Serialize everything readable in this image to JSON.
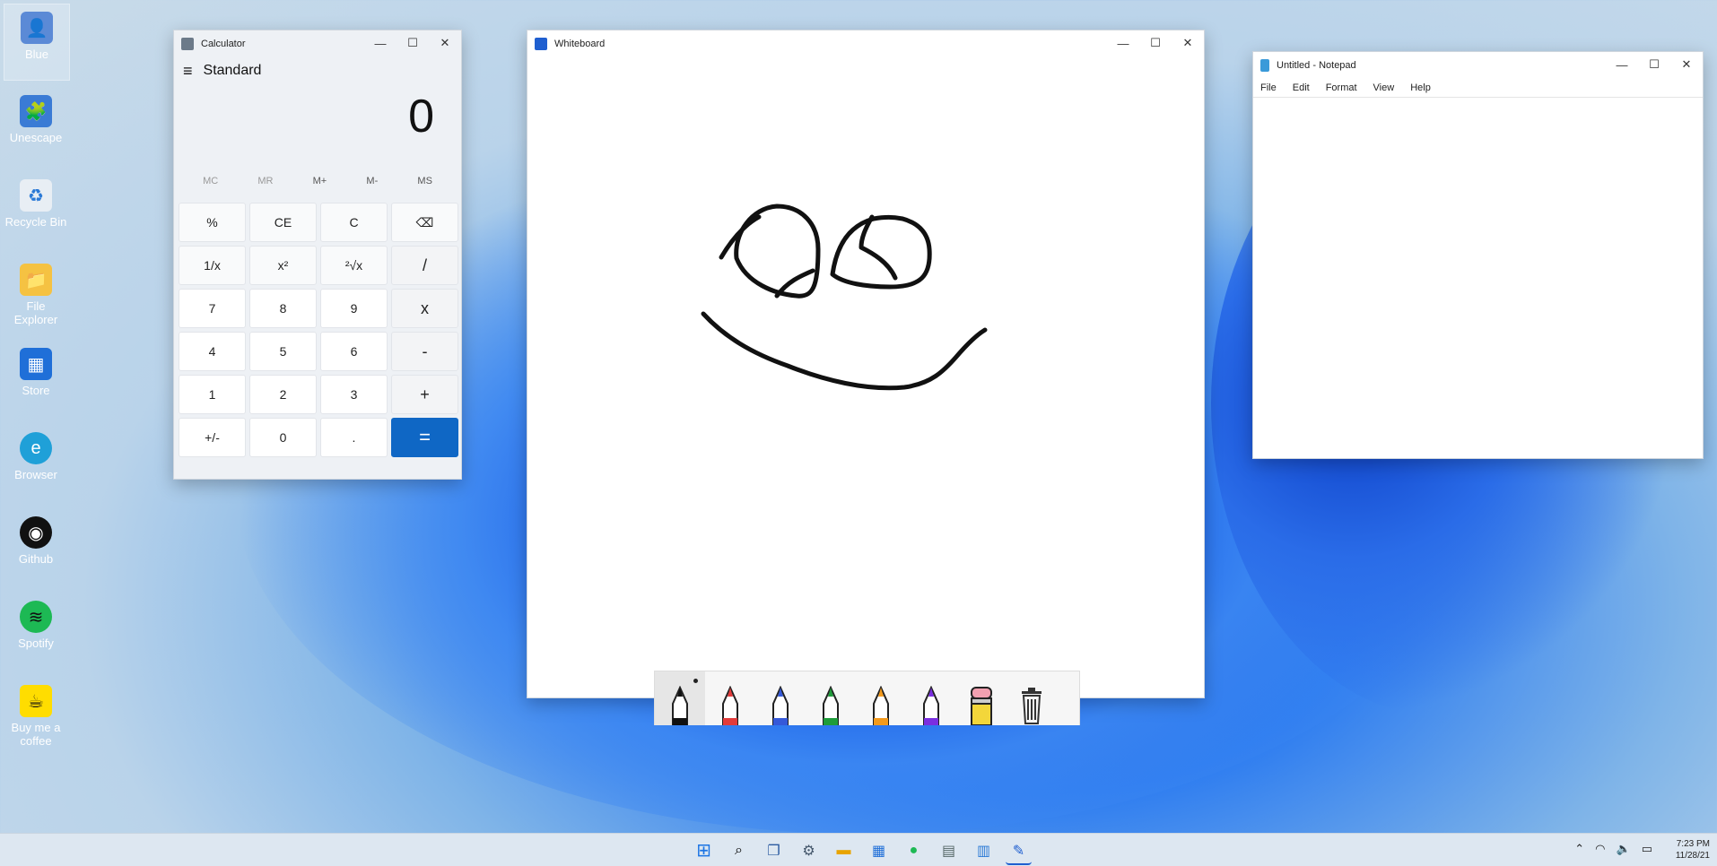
{
  "desktop": {
    "icons": [
      {
        "label": "Blue",
        "icon": "user-icon",
        "color": "#5b8ad6"
      },
      {
        "label": "Unescape",
        "icon": "unescape-icon",
        "color": "#3a7bd5"
      },
      {
        "label": "Recycle Bin",
        "icon": "recycle-bin-icon",
        "color": "#dfe8ef"
      },
      {
        "label": "File Explorer",
        "icon": "folder-icon",
        "color": "#f5c242"
      },
      {
        "label": "Store",
        "icon": "store-icon",
        "color": "#1f6fd8"
      },
      {
        "label": "Browser",
        "icon": "edge-icon",
        "color": "#1fa0d8"
      },
      {
        "label": "Github",
        "icon": "github-icon",
        "color": "#111111"
      },
      {
        "label": "Spotify",
        "icon": "spotify-icon",
        "color": "#1db954"
      },
      {
        "label": "Buy me a coffee",
        "icon": "coffee-icon",
        "color": "#ffdd00"
      }
    ]
  },
  "calculator": {
    "title": "Calculator",
    "mode": "Standard",
    "display": "0",
    "memory": [
      "MC",
      "MR",
      "M+",
      "M-",
      "MS"
    ],
    "keys": [
      "%",
      "CE",
      "C",
      "⌫",
      "1/x",
      "x²",
      "²√x",
      "/",
      "7",
      "8",
      "9",
      "x",
      "4",
      "5",
      "6",
      "-",
      "1",
      "2",
      "3",
      "+",
      "+/-",
      "0",
      ".",
      "="
    ]
  },
  "whiteboard": {
    "title": "Whiteboard",
    "tools": [
      {
        "name": "pen-black",
        "color": "#111111"
      },
      {
        "name": "pen-red",
        "color": "#e23b3b"
      },
      {
        "name": "pen-blue",
        "color": "#3559d9"
      },
      {
        "name": "pen-green",
        "color": "#1f9c3a"
      },
      {
        "name": "pen-orange",
        "color": "#f39a1c"
      },
      {
        "name": "pen-purple",
        "color": "#7a2ee0"
      },
      {
        "name": "eraser",
        "color": "#f3d63a"
      },
      {
        "name": "trash",
        "color": "#333333"
      }
    ]
  },
  "notepad": {
    "title": "Untitled - Notepad",
    "menu": [
      "File",
      "Edit",
      "Format",
      "View",
      "Help"
    ]
  },
  "taskbar": {
    "apps": [
      "start-icon",
      "search-icon",
      "task-view-icon",
      "settings-icon",
      "file-explorer-icon",
      "store-icon",
      "spotify-icon",
      "calculator-icon",
      "notepad-icon",
      "whiteboard-icon"
    ],
    "time": "7:23 PM",
    "date": "11/28/21"
  },
  "colors": {
    "accent": "#0f67c5"
  }
}
